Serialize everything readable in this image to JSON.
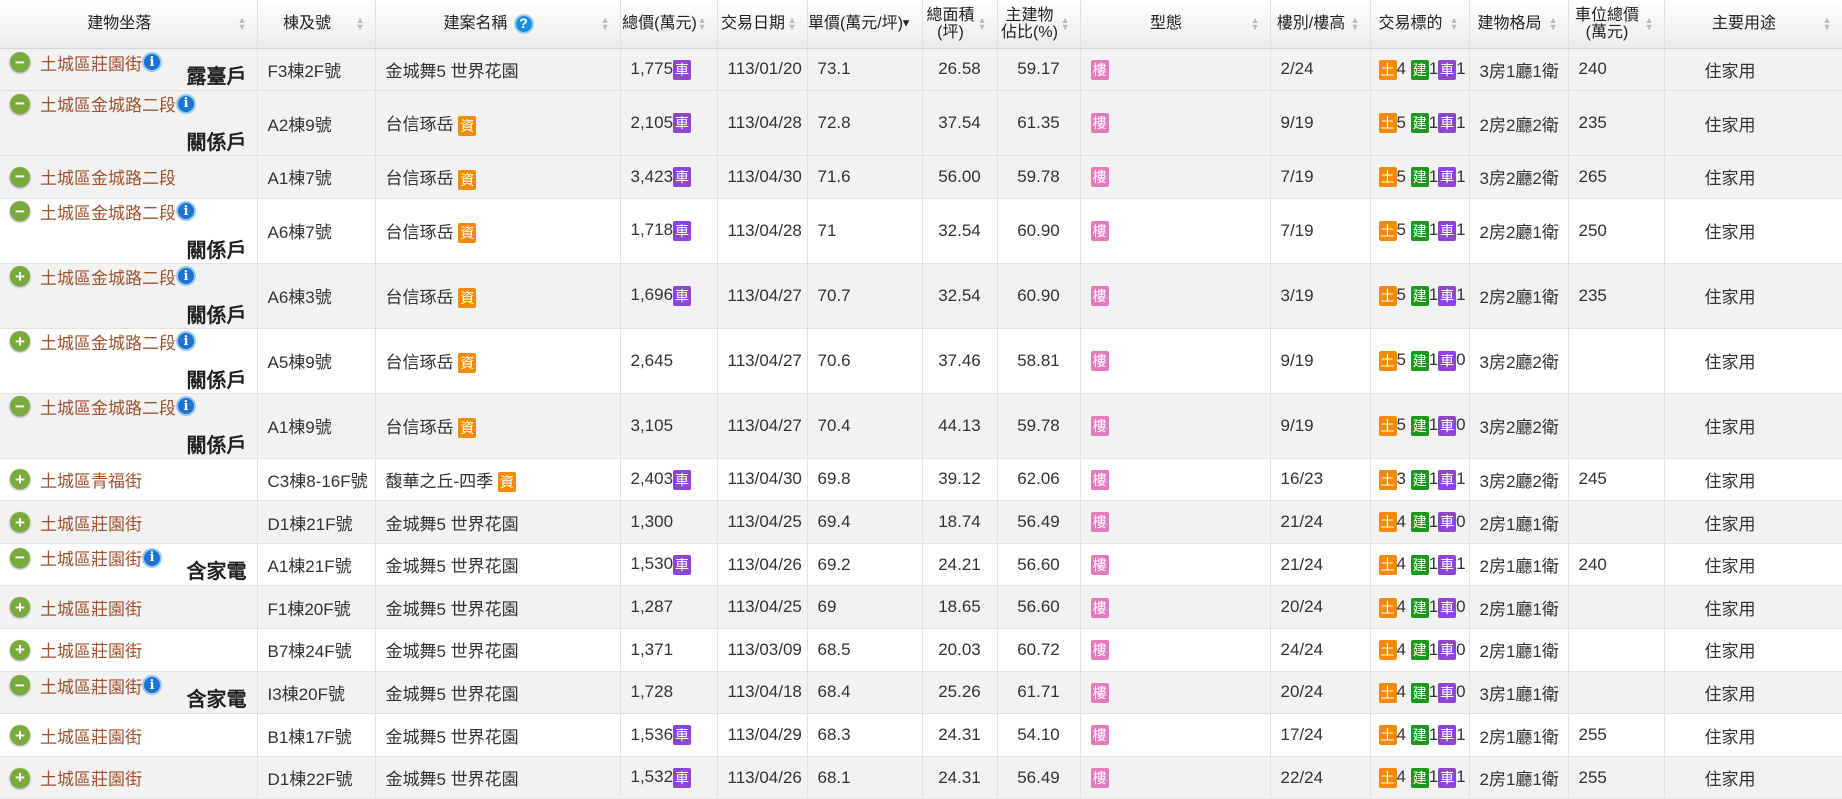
{
  "headers": [
    "建物坐落",
    "棟及號",
    "建案名稱",
    "總價(萬元)",
    "交易日期",
    "單價(萬元/坪)",
    "總面積\n(坪)",
    "主建物\n佔比(%)",
    "型態",
    "樓別/樓高",
    "交易標的",
    "建物格局",
    "車位總價\n(萬元)",
    "主要用途"
  ],
  "sorted_column": "單價(萬元/坪)",
  "sort_direction": "descending",
  "tags": {
    "car": "車",
    "data": "資",
    "type": "樓",
    "land": "土",
    "building": "建"
  },
  "colors": {
    "address": "#a0522d",
    "car": "#8e44d6",
    "data": "#f58a07",
    "type": "#e47bbf",
    "land": "#f58a07",
    "building": "#1a9a1a",
    "expand": "#79aa3b"
  },
  "rows": [
    {
      "expanded": true,
      "addr": "土城區莊園街",
      "info": true,
      "note": "露臺戶",
      "unit": "F3棟2F號",
      "project": "金城舞5 世界花園",
      "data_tag": false,
      "price": "1,775",
      "car_tag": true,
      "date": "113/01/20",
      "unit_price": "73.1",
      "area": "26.58",
      "main_ratio": "59.17",
      "floor": "2/24",
      "land": "4",
      "bld": "1",
      "car": "1",
      "layout": "3房1廳1衛",
      "car_price": "240",
      "use": "住家用"
    },
    {
      "expanded": true,
      "addr": "土城區金城路二段",
      "info": true,
      "note": "關係戶",
      "unit": "A2棟9號",
      "project": "台信琢岳",
      "data_tag": true,
      "price": "2,105",
      "car_tag": true,
      "date": "113/04/28",
      "unit_price": "72.8",
      "area": "37.54",
      "main_ratio": "61.35",
      "floor": "9/19",
      "land": "5",
      "bld": "1",
      "car": "1",
      "layout": "2房2廳2衛",
      "car_price": "235",
      "use": "住家用"
    },
    {
      "expanded": true,
      "addr": "土城區金城路二段",
      "info": false,
      "note": "",
      "unit": "A1棟7號",
      "project": "台信琢岳",
      "data_tag": true,
      "price": "3,423",
      "car_tag": true,
      "date": "113/04/30",
      "unit_price": "71.6",
      "area": "56.00",
      "main_ratio": "59.78",
      "floor": "7/19",
      "land": "5",
      "bld": "1",
      "car": "1",
      "layout": "3房2廳2衛",
      "car_price": "265",
      "use": "住家用"
    },
    {
      "expanded": true,
      "addr": "土城區金城路二段",
      "info": true,
      "note": "關係戶",
      "unit": "A6棟7號",
      "project": "台信琢岳",
      "data_tag": true,
      "price": "1,718",
      "car_tag": true,
      "date": "113/04/28",
      "unit_price": "71",
      "area": "32.54",
      "main_ratio": "60.90",
      "floor": "7/19",
      "land": "5",
      "bld": "1",
      "car": "1",
      "layout": "2房2廳1衛",
      "car_price": "250",
      "use": "住家用"
    },
    {
      "expanded": false,
      "addr": "土城區金城路二段",
      "info": true,
      "note": "關係戶",
      "unit": "A6棟3號",
      "project": "台信琢岳",
      "data_tag": true,
      "price": "1,696",
      "car_tag": true,
      "date": "113/04/27",
      "unit_price": "70.7",
      "area": "32.54",
      "main_ratio": "60.90",
      "floor": "3/19",
      "land": "5",
      "bld": "1",
      "car": "1",
      "layout": "2房2廳1衛",
      "car_price": "235",
      "use": "住家用"
    },
    {
      "expanded": false,
      "addr": "土城區金城路二段",
      "info": true,
      "note": "關係戶",
      "unit": "A5棟9號",
      "project": "台信琢岳",
      "data_tag": true,
      "price": "2,645",
      "car_tag": false,
      "date": "113/04/27",
      "unit_price": "70.6",
      "area": "37.46",
      "main_ratio": "58.81",
      "floor": "9/19",
      "land": "5",
      "bld": "1",
      "car": "0",
      "layout": "3房2廳2衛",
      "car_price": "",
      "use": "住家用"
    },
    {
      "expanded": true,
      "addr": "土城區金城路二段",
      "info": true,
      "note": "關係戶",
      "unit": "A1棟9號",
      "project": "台信琢岳",
      "data_tag": true,
      "price": "3,105",
      "car_tag": false,
      "date": "113/04/27",
      "unit_price": "70.4",
      "area": "44.13",
      "main_ratio": "59.78",
      "floor": "9/19",
      "land": "5",
      "bld": "1",
      "car": "0",
      "layout": "3房2廳2衛",
      "car_price": "",
      "use": "住家用"
    },
    {
      "expanded": false,
      "addr": "土城區青福街",
      "info": false,
      "note": "",
      "unit": "C3棟8-16F號",
      "project": "馥華之丘-四季",
      "data_tag": true,
      "price": "2,403",
      "car_tag": true,
      "date": "113/04/30",
      "unit_price": "69.8",
      "area": "39.12",
      "main_ratio": "62.06",
      "floor": "16/23",
      "land": "3",
      "bld": "1",
      "car": "1",
      "layout": "3房2廳2衛",
      "car_price": "245",
      "use": "住家用"
    },
    {
      "expanded": false,
      "addr": "土城區莊園街",
      "info": false,
      "note": "",
      "unit": "D1棟21F號",
      "project": "金城舞5 世界花園",
      "data_tag": false,
      "price": "1,300",
      "car_tag": false,
      "date": "113/04/25",
      "unit_price": "69.4",
      "area": "18.74",
      "main_ratio": "56.49",
      "floor": "21/24",
      "land": "4",
      "bld": "1",
      "car": "0",
      "layout": "2房1廳1衛",
      "car_price": "",
      "use": "住家用"
    },
    {
      "expanded": true,
      "addr": "土城區莊園街",
      "info": true,
      "note": "含家電",
      "unit": "A1棟21F號",
      "project": "金城舞5 世界花園",
      "data_tag": false,
      "price": "1,530",
      "car_tag": true,
      "date": "113/04/26",
      "unit_price": "69.2",
      "area": "24.21",
      "main_ratio": "56.60",
      "floor": "21/24",
      "land": "4",
      "bld": "1",
      "car": "1",
      "layout": "2房1廳1衛",
      "car_price": "240",
      "use": "住家用"
    },
    {
      "expanded": false,
      "addr": "土城區莊園街",
      "info": false,
      "note": "",
      "unit": "F1棟20F號",
      "project": "金城舞5 世界花園",
      "data_tag": false,
      "price": "1,287",
      "car_tag": false,
      "date": "113/04/25",
      "unit_price": "69",
      "area": "18.65",
      "main_ratio": "56.60",
      "floor": "20/24",
      "land": "4",
      "bld": "1",
      "car": "0",
      "layout": "2房1廳1衛",
      "car_price": "",
      "use": "住家用"
    },
    {
      "expanded": false,
      "addr": "土城區莊園街",
      "info": false,
      "note": "",
      "unit": "B7棟24F號",
      "project": "金城舞5 世界花園",
      "data_tag": false,
      "price": "1,371",
      "car_tag": false,
      "date": "113/03/09",
      "unit_price": "68.5",
      "area": "20.03",
      "main_ratio": "60.72",
      "floor": "24/24",
      "land": "4",
      "bld": "1",
      "car": "0",
      "layout": "2房1廳1衛",
      "car_price": "",
      "use": "住家用"
    },
    {
      "expanded": true,
      "addr": "土城區莊園街",
      "info": true,
      "note": "含家電",
      "unit": "I3棟20F號",
      "project": "金城舞5 世界花園",
      "data_tag": false,
      "price": "1,728",
      "car_tag": false,
      "date": "113/04/18",
      "unit_price": "68.4",
      "area": "25.26",
      "main_ratio": "61.71",
      "floor": "20/24",
      "land": "4",
      "bld": "1",
      "car": "0",
      "layout": "3房1廳1衛",
      "car_price": "",
      "use": "住家用"
    },
    {
      "expanded": false,
      "addr": "土城區莊園街",
      "info": false,
      "note": "",
      "unit": "B1棟17F號",
      "project": "金城舞5 世界花園",
      "data_tag": false,
      "price": "1,536",
      "car_tag": true,
      "date": "113/04/29",
      "unit_price": "68.3",
      "area": "24.31",
      "main_ratio": "54.10",
      "floor": "17/24",
      "land": "4",
      "bld": "1",
      "car": "1",
      "layout": "2房1廳1衛",
      "car_price": "255",
      "use": "住家用"
    },
    {
      "expanded": false,
      "addr": "土城區莊園街",
      "info": false,
      "note": "",
      "unit": "D1棟22F號",
      "project": "金城舞5 世界花園",
      "data_tag": false,
      "price": "1,532",
      "car_tag": true,
      "date": "113/04/26",
      "unit_price": "68.1",
      "area": "24.31",
      "main_ratio": "56.49",
      "floor": "22/24",
      "land": "4",
      "bld": "1",
      "car": "1",
      "layout": "2房1廳1衛",
      "car_price": "255",
      "use": "住家用"
    }
  ]
}
